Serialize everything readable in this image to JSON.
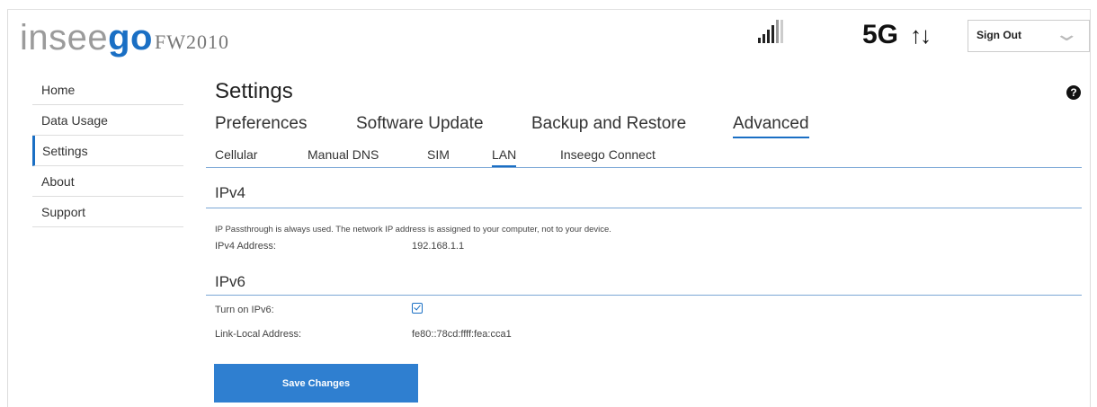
{
  "header": {
    "logo_prefix": "insee",
    "logo_suffix": "go",
    "model": "FW2010",
    "network": "5G",
    "network_arrows": "↑↓",
    "sign_out_label": "Sign Out"
  },
  "sidebar": {
    "items": [
      {
        "label": "Home"
      },
      {
        "label": "Data Usage"
      },
      {
        "label": "Settings"
      },
      {
        "label": "About"
      },
      {
        "label": "Support"
      }
    ],
    "active": "Settings"
  },
  "page": {
    "title": "Settings",
    "help_label": "?"
  },
  "tabs": {
    "items": [
      "Preferences",
      "Software Update",
      "Backup and Restore",
      "Advanced"
    ],
    "selected": "Advanced"
  },
  "subtabs": {
    "items": [
      "Cellular",
      "Manual DNS",
      "SIM",
      "LAN",
      "Inseego Connect"
    ],
    "selected": "LAN"
  },
  "ipv4": {
    "heading": "IPv4",
    "note": "IP Passthrough is always used. The network IP address is assigned to your computer, not to your device.",
    "address_label": "IPv4 Address:",
    "address_value": "192.168.1.1"
  },
  "ipv6": {
    "heading": "IPv6",
    "turn_on_label": "Turn on IPv6:",
    "turn_on_checked": true,
    "link_local_label": "Link-Local Address:",
    "link_local_value": "fe80::78cd:ffff:fea:cca1"
  },
  "save_label": "Save Changes",
  "colors": {
    "accent": "#1a6fc4",
    "button": "#2f7fd0",
    "logo_gray": "#9b9b9b"
  }
}
